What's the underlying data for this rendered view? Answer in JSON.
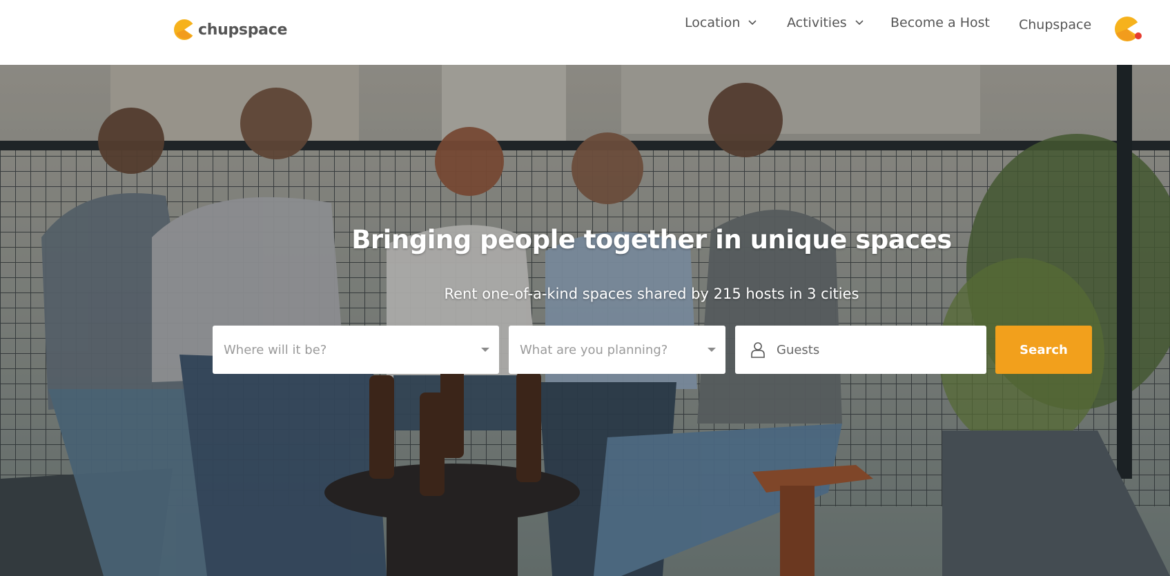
{
  "brand": {
    "name": "chupspace"
  },
  "nav": {
    "items": [
      {
        "label": "Location",
        "has_dropdown": true
      },
      {
        "label": "Activities",
        "has_dropdown": true
      },
      {
        "label": "Become a Host",
        "has_dropdown": false
      },
      {
        "label": "Chupspace",
        "has_dropdown": false
      }
    ]
  },
  "hero": {
    "title": "Bringing people together in unique spaces",
    "subtitle": "Rent one-of-a-kind spaces shared by 215 hosts in 3 cities"
  },
  "search": {
    "location_placeholder": "Where will it be?",
    "activity_placeholder": "What are you planning?",
    "guests_placeholder": "Guests",
    "button_label": "Search"
  },
  "colors": {
    "accent": "#f2a01c",
    "logo_yellow": "#f6b21c",
    "logo_orange": "#ef8a1e",
    "notification_dot": "#e63b2e",
    "nav_text": "#555555"
  },
  "icons": {
    "logo": "chupspace-logo-icon",
    "dropdown": "chevron-down-icon",
    "select": "caret-down-icon",
    "guests": "person-icon",
    "avatar": "user-avatar-icon"
  }
}
